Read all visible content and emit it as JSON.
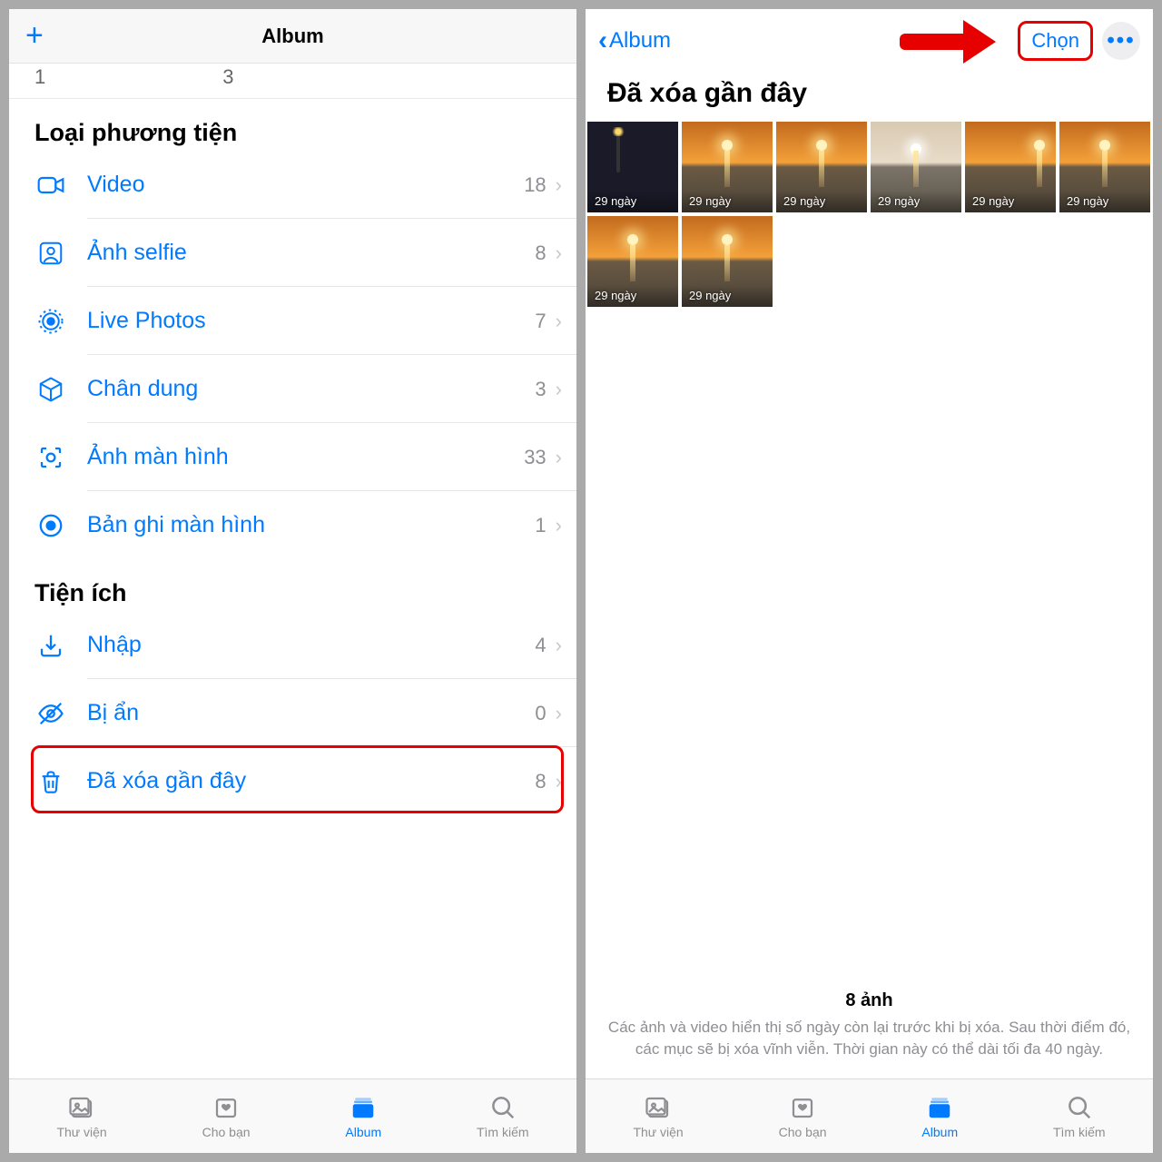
{
  "left": {
    "header_title": "Album",
    "top_numbers": [
      "1",
      "3"
    ],
    "sections": [
      {
        "title": "Loại phương tiện",
        "rows": [
          {
            "icon": "video",
            "label": "Video",
            "count": "18"
          },
          {
            "icon": "selfie",
            "label": "Ảnh selfie",
            "count": "8"
          },
          {
            "icon": "live",
            "label": "Live Photos",
            "count": "7"
          },
          {
            "icon": "portrait",
            "label": "Chân dung",
            "count": "3"
          },
          {
            "icon": "screenshot",
            "label": "Ảnh màn hình",
            "count": "33"
          },
          {
            "icon": "record",
            "label": "Bản ghi màn hình",
            "count": "1"
          }
        ]
      },
      {
        "title": "Tiện ích",
        "rows": [
          {
            "icon": "import",
            "label": "Nhập",
            "count": "4"
          },
          {
            "icon": "hidden",
            "label": "Bị ẩn",
            "count": "0"
          },
          {
            "icon": "trash",
            "label": "Đã xóa gần đây",
            "count": "8",
            "highlight": true
          }
        ]
      }
    ]
  },
  "right": {
    "back_label": "Album",
    "select_label": "Chọn",
    "page_title": "Đã xóa gần đây",
    "thumbs": [
      {
        "badge": "29 ngày",
        "style": "night"
      },
      {
        "badge": "29 ngày",
        "style": "sunset"
      },
      {
        "badge": "29 ngày",
        "style": "sunset"
      },
      {
        "badge": "29 ngày",
        "style": "pale"
      },
      {
        "badge": "29 ngày",
        "style": "sunset-right"
      },
      {
        "badge": "29 ngày",
        "style": "sunset"
      },
      {
        "badge": "29 ngày",
        "style": "sunset"
      },
      {
        "badge": "29 ngày",
        "style": "sunset"
      }
    ],
    "meta_count": "8 ảnh",
    "meta_text": "Các ảnh và video hiển thị số ngày còn lại trước khi bị xóa. Sau thời điểm đó, các mục sẽ bị xóa vĩnh viễn. Thời gian này có thể dài tối đa 40 ngày."
  },
  "tabs": [
    {
      "label": "Thư viện",
      "icon": "library"
    },
    {
      "label": "Cho bạn",
      "icon": "foryou"
    },
    {
      "label": "Album",
      "icon": "album",
      "active": true
    },
    {
      "label": "Tìm kiếm",
      "icon": "search"
    }
  ]
}
